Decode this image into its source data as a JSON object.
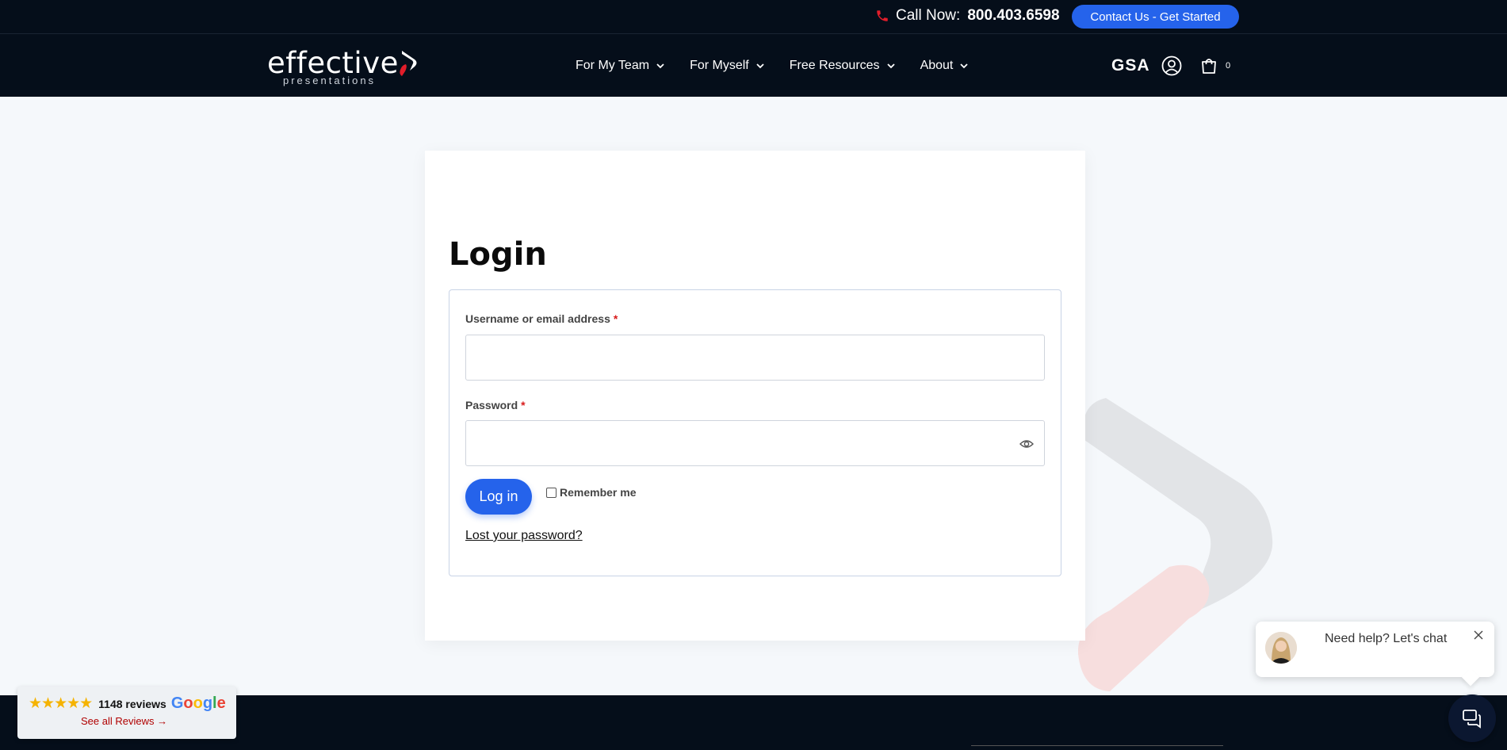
{
  "topbar": {
    "call_label": "Call Now:",
    "phone": "800.403.6598",
    "cta_label": "Contact Us - Get Started"
  },
  "header": {
    "logo_word": "effective",
    "logo_sub": "presentations",
    "nav": [
      {
        "label": "For My Team"
      },
      {
        "label": "For Myself"
      },
      {
        "label": "Free Resources"
      },
      {
        "label": "About"
      }
    ],
    "gsa": "GSA",
    "cart_count": "0"
  },
  "login": {
    "title": "Login",
    "username_label": "Username or email address",
    "password_label": "Password",
    "required_mark": "*",
    "username_value": "",
    "password_value": "",
    "login_button": "Log in",
    "remember_label": "Remember me",
    "lost_password": "Lost your password?"
  },
  "reviews": {
    "stars": "★★★★★",
    "count_label": "1148 reviews",
    "brand": "Google",
    "see_all": "See all Reviews →"
  },
  "chat": {
    "message": "Need help? Let's chat"
  },
  "colors": {
    "accent": "#2563eb",
    "dark": "#050e1a",
    "brand_red": "#e11d2a"
  }
}
